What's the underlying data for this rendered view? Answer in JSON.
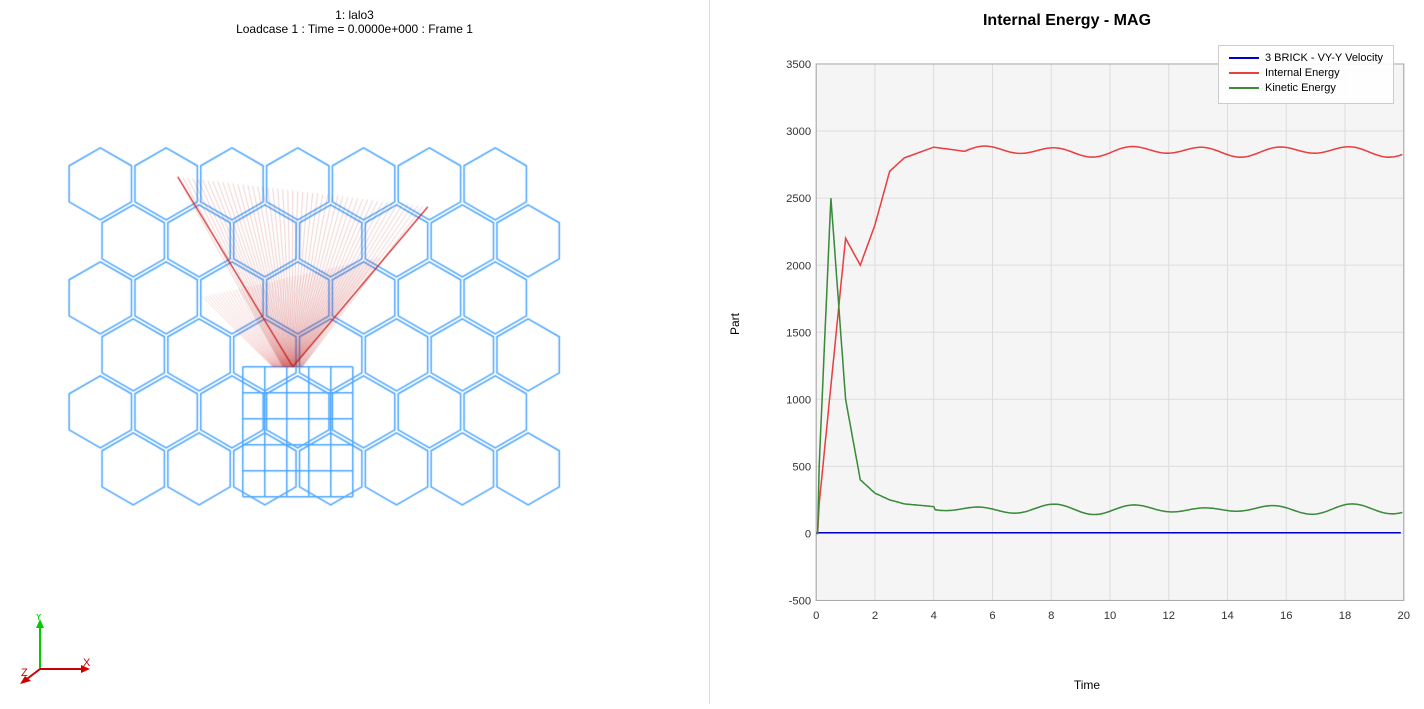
{
  "viewport": {
    "title_line1": "1: lalo3",
    "title_line2": "Loadcase 1 : Time = 0.0000e+000 : Frame 1"
  },
  "chart": {
    "title": "Internal Energy - MAG",
    "y_axis_label": "Part",
    "x_axis_label": "Time",
    "y_min": -500,
    "y_max": 3500,
    "x_min": 0,
    "x_max": 20,
    "y_ticks": [
      -500,
      0,
      500,
      1000,
      1500,
      2000,
      2500,
      3000,
      3500
    ],
    "x_ticks": [
      0,
      2,
      4,
      6,
      8,
      10,
      12,
      14,
      16,
      18,
      20
    ]
  },
  "legend": {
    "items": [
      {
        "label": "3 BRICK - VY-Y Velocity",
        "color": "#0000cd"
      },
      {
        "label": "Internal Energy",
        "color": "#e84040"
      },
      {
        "label": "Kinetic Energy",
        "color": "#3a8a3a"
      }
    ]
  },
  "axis": {
    "y_label": "Y",
    "x_label": "X",
    "z_label": "Z"
  }
}
